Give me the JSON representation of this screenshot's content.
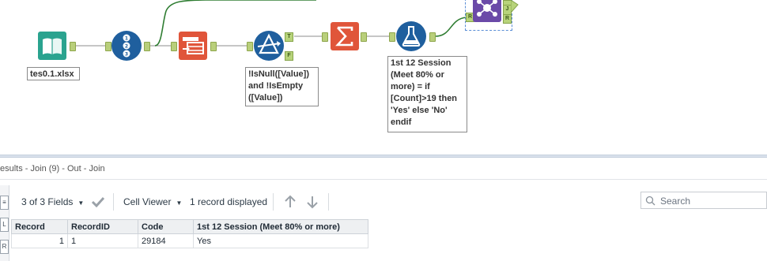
{
  "canvas": {
    "input_annotation": "tes0.1.xlsx",
    "filter_annotation": "!IsNull([Value])\nand !IsEmpty\n([Value])",
    "formula_annotation": "1st 12 Session\n(Meet 80% or\nmore) = if\n[Count]>19 then\n'Yes' else 'No'\nendif",
    "filter_true_anchor": "T",
    "filter_false_anchor": "F",
    "join_right_anchor": "R",
    "join_j_anchor": "J",
    "join_r_anchor": "R"
  },
  "results": {
    "title": "esults - Join (9) - Out - Join",
    "fields_label": "3 of 3 Fields",
    "viewer_label": "Cell Viewer",
    "records_label": "1 record displayed",
    "search_placeholder": "Search",
    "side_icons": [
      "≡",
      "L",
      "R"
    ],
    "columns": [
      "Record",
      "RecordID",
      "Code",
      "1st 12 Session (Meet 80% or more)"
    ],
    "rows": [
      [
        "1",
        "1",
        "29184",
        "Yes"
      ]
    ]
  },
  "colors": {
    "input_tool": "#2aa38f",
    "record_id_tool": "#1f5f9e",
    "select_tool": "#e0553a",
    "filter_tool": "#1f5f9e",
    "summarize_tool": "#e0553a",
    "formula_tool": "#1f5f9e",
    "join_tool": "#6b4aa8",
    "connection": "#2f7d32"
  }
}
